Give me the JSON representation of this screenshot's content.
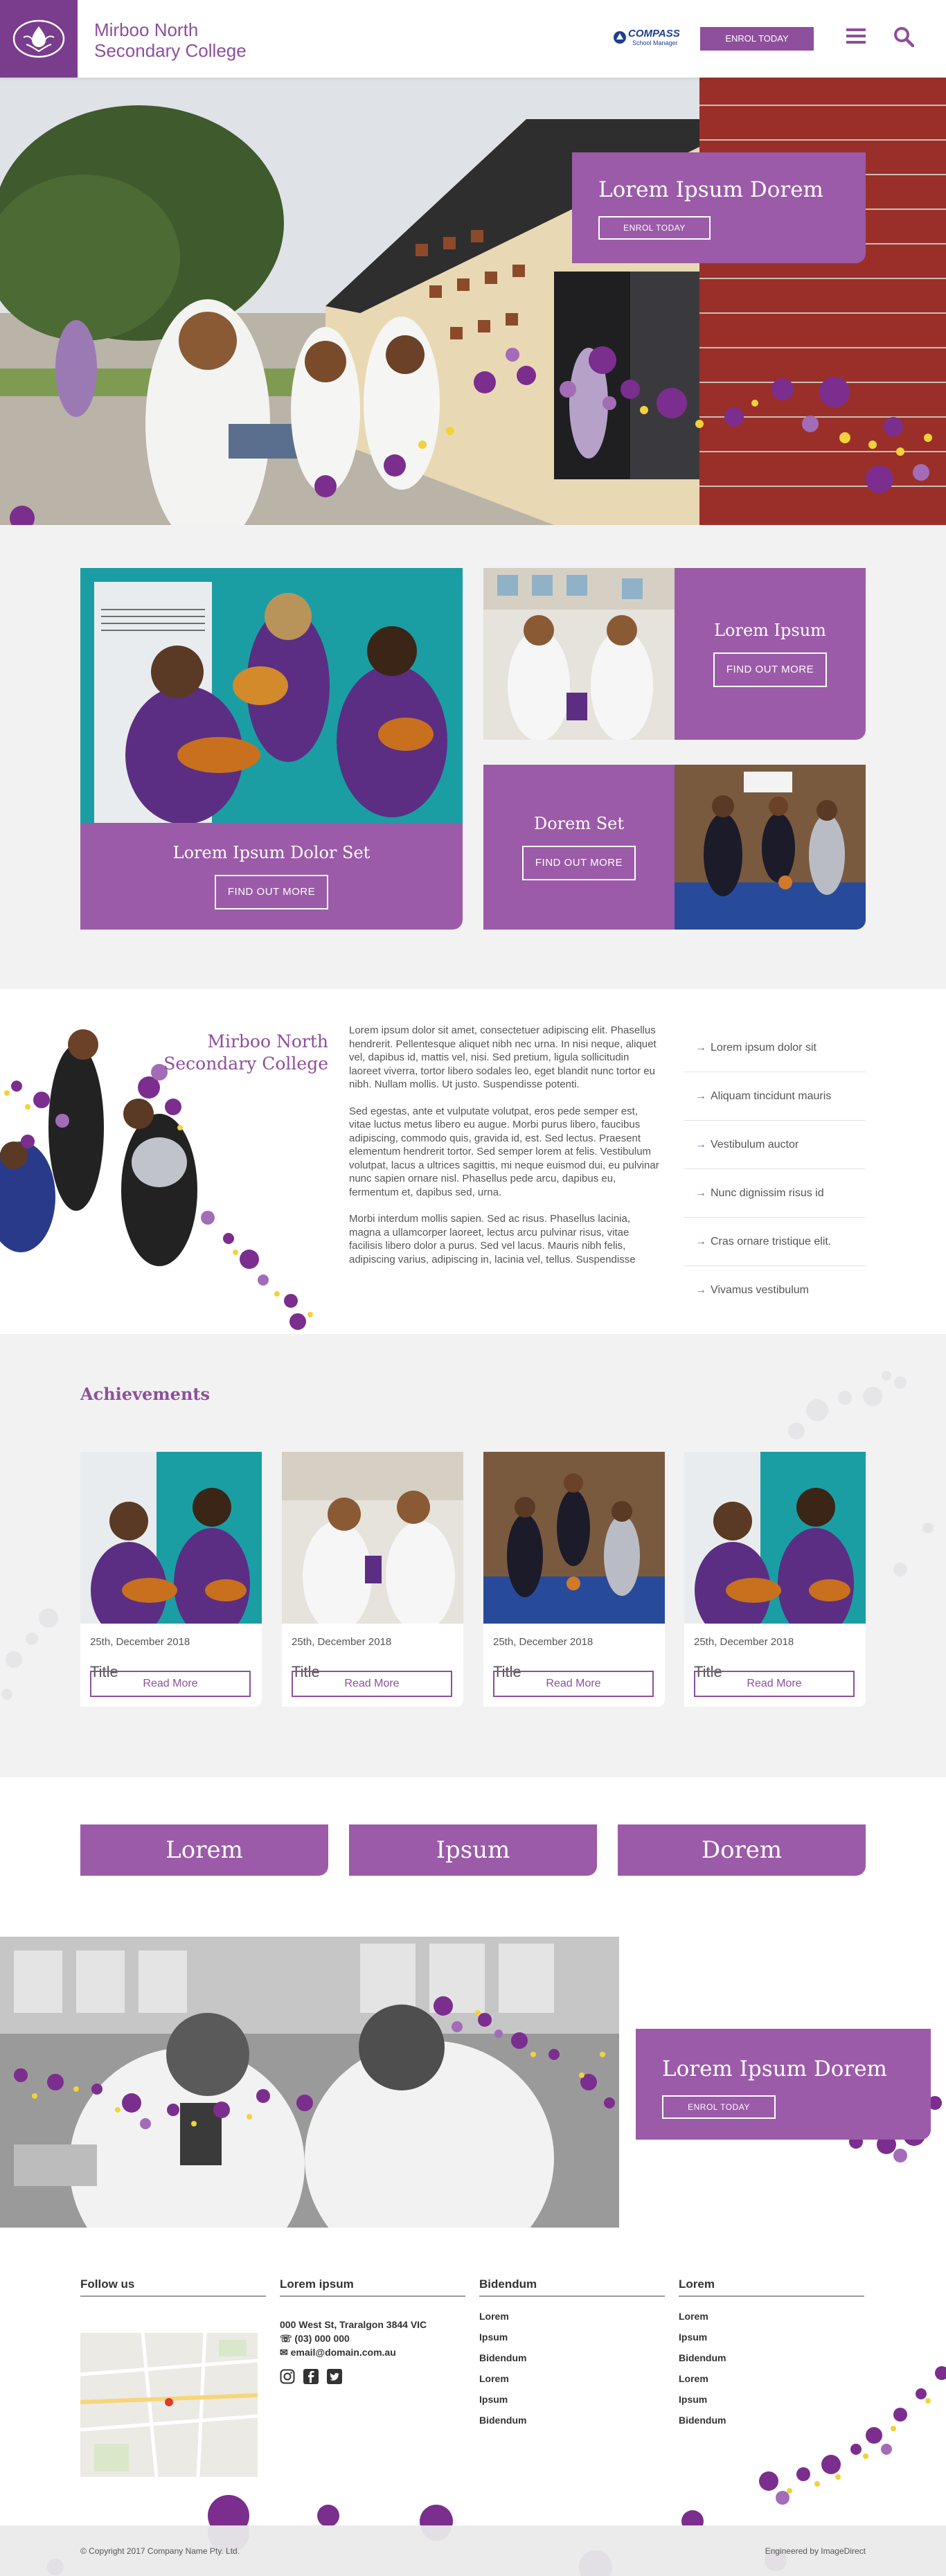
{
  "header": {
    "school_name_line1": "Mirboo North",
    "school_name_line2": "Secondary College",
    "compass_name": "COMPASS",
    "compass_sub": "School Manager",
    "enrol_label": "ENROL TODAY"
  },
  "hero": {
    "title": "Lorem Ipsum Dorem",
    "button_label": "ENROL TODAY"
  },
  "features": [
    {
      "title": "Lorem Ipsum Dolor Set",
      "button_label": "FIND OUT MORE"
    },
    {
      "title": "Lorem Ipsum",
      "button_label": "FIND OUT MORE"
    },
    {
      "title": "Dorem Set",
      "button_label": "FIND OUT MORE"
    }
  ],
  "about": {
    "title_line1": "Mirboo North",
    "title_line2": "Secondary College",
    "paragraphs": [
      "Lorem ipsum dolor sit amet, consectetuer adipiscing elit. Phasellus hendrerit. Pellentesque aliquet nibh nec urna. In nisi neque, aliquet vel, dapibus id, mattis vel, nisi. Sed pretium, ligula sollicitudin laoreet viverra, tortor libero sodales leo, eget blandit nunc tortor eu nibh. Nullam mollis. Ut justo. Suspendisse potenti.",
      "Sed egestas, ante et vulputate volutpat, eros pede semper est, vitae luctus metus libero eu augue. Morbi purus libero, faucibus adipiscing, commodo quis, gravida id, est. Sed lectus. Praesent elementum hendrerit tortor. Sed semper lorem at felis. Vestibulum volutpat, lacus a ultrices sagittis, mi neque euismod dui, eu pulvinar nunc sapien ornare nisl. Phasellus pede arcu, dapibus eu, fermentum et, dapibus sed, urna.",
      "Morbi interdum mollis sapien. Sed ac risus. Phasellus lacinia, magna a ullamcorper laoreet, lectus arcu pulvinar risus, vitae facilisis libero dolor a purus. Sed vel lacus. Mauris nibh felis, adipiscing varius, adipiscing in, lacinia vel, tellus. Suspendisse"
    ],
    "links": [
      "Lorem ipsum dolor sit",
      "Aliquam tincidunt mauris",
      "Vestibulum auctor",
      "Nunc dignissim risus id",
      "Cras ornare tristique elit.",
      "Vivamus vestibulum"
    ]
  },
  "achievements": {
    "heading": "Achievements",
    "cards": [
      {
        "date": "25th, December 2018",
        "title": "Title",
        "button_label": "Read More"
      },
      {
        "date": "25th, December 2018",
        "title": "Title",
        "button_label": "Read More"
      },
      {
        "date": "25th, December 2018",
        "title": "Title",
        "button_label": "Read More"
      },
      {
        "date": "25th, December 2018",
        "title": "Title",
        "button_label": "Read More"
      }
    ]
  },
  "big_buttons": [
    "Lorem",
    "Ipsum",
    "Dorem"
  ],
  "science": {
    "title": "Lorem Ipsum Dorem",
    "button_label": "ENROL TODAY"
  },
  "footer": {
    "follow_heading": "Follow us",
    "contact_heading": "Lorem ipsum",
    "address": "000 West St, Traralgon 3844 VIC",
    "phone": "(03) 000 000",
    "email": "email@domain.com.au",
    "col3_heading": "Bidendum",
    "col3_items": [
      "Lorem",
      "Ipsum",
      "Bidendum",
      "Lorem",
      "Ipsum",
      "Bidendum"
    ],
    "col4_heading": "Lorem",
    "col4_items": [
      "Lorem",
      "Ipsum",
      "Bidendum",
      "Lorem",
      "Ipsum",
      "Bidendum"
    ],
    "copyright": "© Copyright 2017  Company Name Pty. Ltd.",
    "engineered": "Engineered by ImageDirect"
  },
  "icons": {
    "menu": "hamburger-menu-icon",
    "search": "search-icon",
    "arrow": "arrow-right-icon",
    "phone": "phone-icon",
    "email": "envelope-icon",
    "instagram": "instagram-icon",
    "facebook": "facebook-icon",
    "twitter": "twitter-icon"
  },
  "colors": {
    "brand_purple": "#8e4f9c",
    "tile_purple": "#9b5ba8",
    "logo_purple": "#7a3c8c",
    "dot_yellow": "#f2d23a"
  }
}
